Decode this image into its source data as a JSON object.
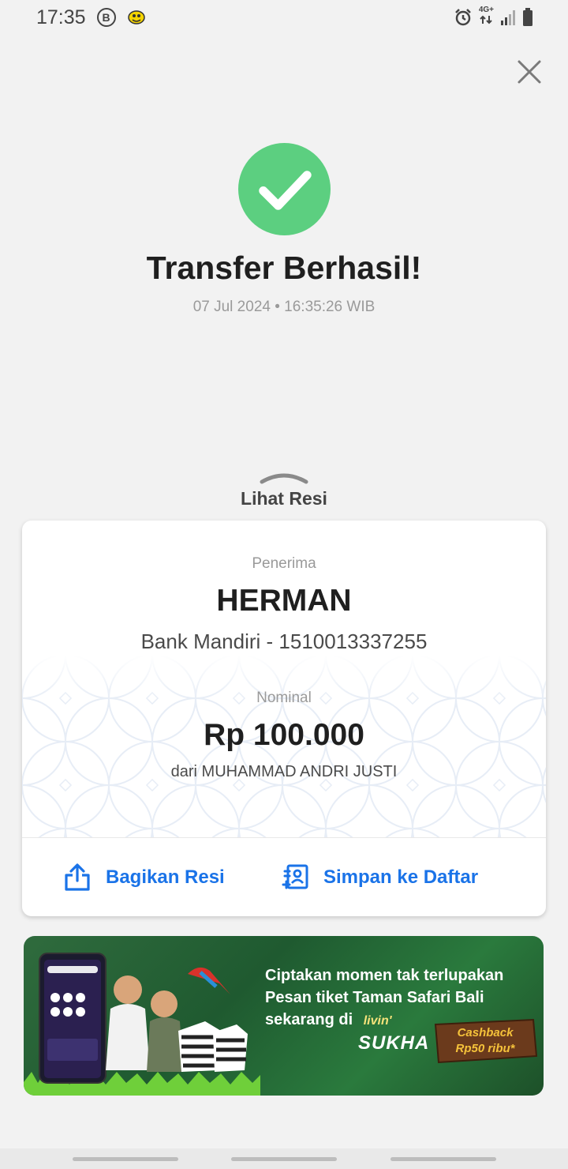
{
  "status_bar": {
    "time": "17:35",
    "b_icon_letter": "B",
    "network": "4G+"
  },
  "header": {
    "close_icon": "close-icon"
  },
  "result": {
    "title": "Transfer Berhasil!",
    "datetime": "07 Jul 2024 • 16:35:26 WIB",
    "status_color": "#5ccf80"
  },
  "receipt_toggle": {
    "label": "Lihat Resi"
  },
  "receipt": {
    "recipient_label": "Penerima",
    "recipient_name": "HERMAN",
    "recipient_bank": "Bank Mandiri - 1510013337255",
    "nominal_label": "Nominal",
    "amount": "Rp 100.000",
    "sender": "dari MUHAMMAD ANDRI JUSTI"
  },
  "actions": {
    "share_label": "Bagikan Resi",
    "save_label": "Simpan ke Daftar",
    "accent_color": "#1a73e8"
  },
  "promo": {
    "line1": "Ciptakan momen tak terlupakan",
    "line2": "Pesan tiket Taman Safari Bali",
    "line3": "sekarang di",
    "brand_small": "livin'",
    "brand_big": "SUKHA",
    "cashback_line1": "Cashback",
    "cashback_line2": "Rp50 ribu*"
  }
}
